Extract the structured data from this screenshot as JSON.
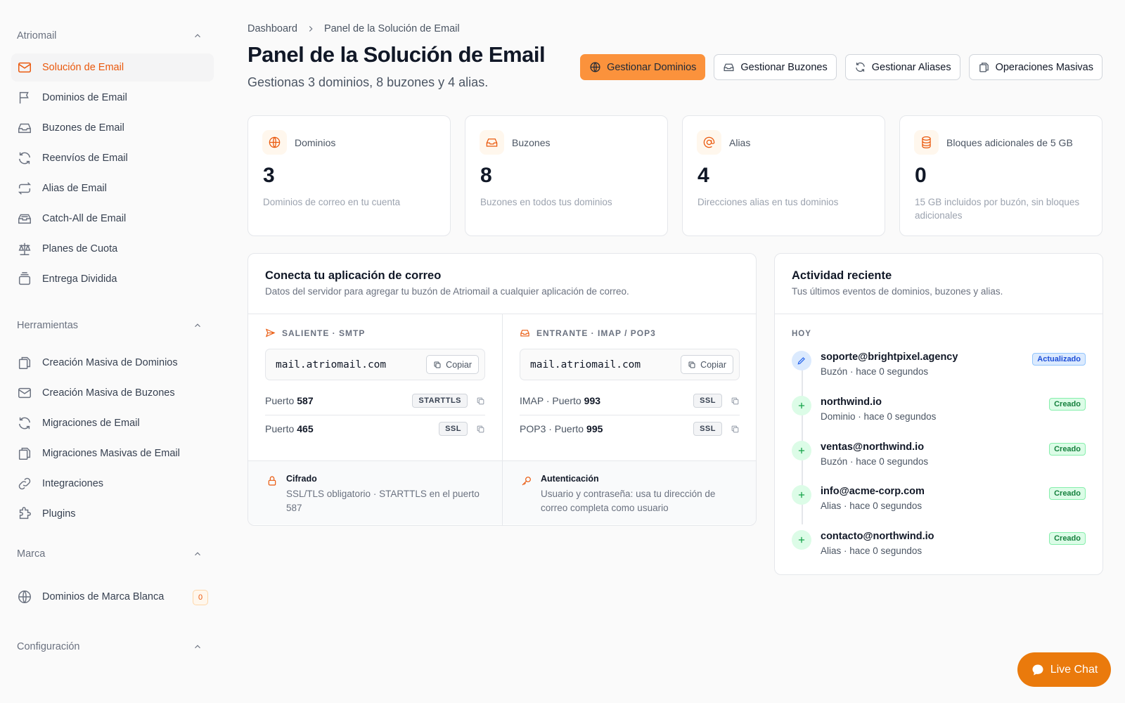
{
  "sidebar": {
    "sections": [
      {
        "title": "Atriomail",
        "items": [
          {
            "label": "Solución de Email",
            "icon": "mail-icon",
            "active": true
          },
          {
            "label": "Dominios de Email",
            "icon": "flag-icon"
          },
          {
            "label": "Buzones de Email",
            "icon": "inbox-icon"
          },
          {
            "label": "Reenvíos de Email",
            "icon": "refresh-icon"
          },
          {
            "label": "Alias de Email",
            "icon": "repeat-icon"
          },
          {
            "label": "Catch-All de Email",
            "icon": "archive-icon"
          },
          {
            "label": "Planes de Cuota",
            "icon": "scale-icon"
          },
          {
            "label": "Entrega Dividida",
            "icon": "layers-icon"
          }
        ]
      },
      {
        "title": "Herramientas",
        "items": [
          {
            "label": "Creación Masiva de Dominios",
            "icon": "copy-icon"
          },
          {
            "label": "Creación Masiva de Buzones",
            "icon": "mail-icon"
          },
          {
            "label": "Migraciones de Email",
            "icon": "refresh-icon"
          },
          {
            "label": "Migraciones Masivas de Email",
            "icon": "copy-icon"
          },
          {
            "label": "Integraciones",
            "icon": "link-icon"
          },
          {
            "label": "Plugins",
            "icon": "puzzle-icon"
          }
        ]
      },
      {
        "title": "Marca",
        "items": [
          {
            "label": "Dominios de Marca Blanca",
            "icon": "globe-icon",
            "badge": "0"
          }
        ]
      },
      {
        "title": "Configuración",
        "items": []
      }
    ]
  },
  "breadcrumb": {
    "root": "Dashboard",
    "current": "Panel de la Solución de Email"
  },
  "page": {
    "title": "Panel de la Solución de Email",
    "subtitle": "Gestionas 3 dominios, 8 buzones y 4 alias."
  },
  "actions": {
    "domains": "Gestionar Dominios",
    "mailboxes": "Gestionar Buzones",
    "aliases": "Gestionar Aliases",
    "bulk": "Operaciones Masivas"
  },
  "stats": [
    {
      "label": "Dominios",
      "value": "3",
      "desc": "Dominios de correo en tu cuenta",
      "icon": "globe-icon"
    },
    {
      "label": "Buzones",
      "value": "8",
      "desc": "Buzones en todos tus dominios",
      "icon": "inbox-icon"
    },
    {
      "label": "Alias",
      "value": "4",
      "desc": "Direcciones alias en tus dominios",
      "icon": "at-icon"
    },
    {
      "label": "Bloques adicionales de 5 GB",
      "value": "0",
      "desc": "15 GB incluidos por buzón, sin bloques adicionales",
      "icon": "database-icon"
    }
  ],
  "connect": {
    "title": "Conecta tu aplicación de correo",
    "subtitle": "Datos del servidor para agregar tu buzón de Atriomail a cualquier aplicación de correo.",
    "copy_label": "Copiar",
    "outgoing": {
      "heading": "SALIENTE · SMTP",
      "host": "mail.atriomail.com",
      "rows": [
        {
          "prefix": "Puerto",
          "port": "587",
          "tag": "STARTTLS"
        },
        {
          "prefix": "Puerto",
          "port": "465",
          "tag": "SSL"
        }
      ]
    },
    "incoming": {
      "heading": "ENTRANTE · IMAP / POP3",
      "host": "mail.atriomail.com",
      "rows": [
        {
          "prefix": "IMAP · Puerto",
          "port": "993",
          "tag": "SSL"
        },
        {
          "prefix": "POP3 · Puerto",
          "port": "995",
          "tag": "SSL"
        }
      ]
    },
    "encryption": {
      "title": "Cifrado",
      "desc": "SSL/TLS obligatorio · STARTTLS en el puerto 587"
    },
    "auth": {
      "title": "Autenticación",
      "desc": "Usuario y contraseña: usa tu dirección de correo completa como usuario"
    }
  },
  "activity": {
    "title": "Actividad reciente",
    "subtitle": "Tus últimos eventos de dominios, buzones y alias.",
    "group": "HOY",
    "events": [
      {
        "title": "soporte@brightpixel.agency",
        "desc": "Buzón · hace 0 segundos",
        "badge": "Actualizado",
        "kind": "updated"
      },
      {
        "title": "northwind.io",
        "desc": "Dominio · hace 0 segundos",
        "badge": "Creado",
        "kind": "created"
      },
      {
        "title": "ventas@northwind.io",
        "desc": "Buzón · hace 0 segundos",
        "badge": "Creado",
        "kind": "created"
      },
      {
        "title": "info@acme-corp.com",
        "desc": "Alias · hace 0 segundos",
        "badge": "Creado",
        "kind": "created"
      },
      {
        "title": "contacto@northwind.io",
        "desc": "Alias · hace 0 segundos",
        "badge": "Creado",
        "kind": "created"
      }
    ]
  },
  "livechat": {
    "label": "Live Chat"
  },
  "colors": {
    "accent": "#ea580c",
    "primary_button": "#fb923c",
    "livechat": "#ea7a0c"
  }
}
